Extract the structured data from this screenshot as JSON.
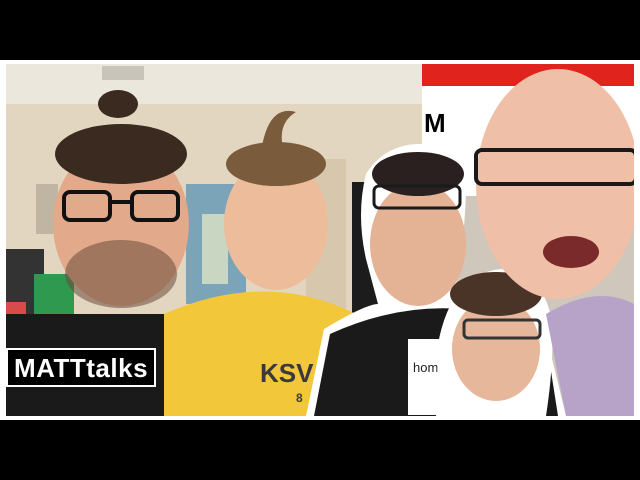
{
  "thumbnail": {
    "channel_label": "MATTtalks",
    "shirt_text": "home.",
    "shirt_text_partial": "KSV",
    "shirt_number": "8",
    "sign_letter": "M"
  },
  "colors": {
    "letterbox": "#000000",
    "border": "#ffffff",
    "wall": "#e3d6c0",
    "ceiling": "#ece7dc",
    "yellow_shirt": "#f2c73a",
    "black_shirt": "#1a1a1a",
    "red_sign": "#e0231c",
    "purple_hoodie": "#b7a3c8",
    "skin": "#e8b496",
    "hair": "#4a3428"
  }
}
